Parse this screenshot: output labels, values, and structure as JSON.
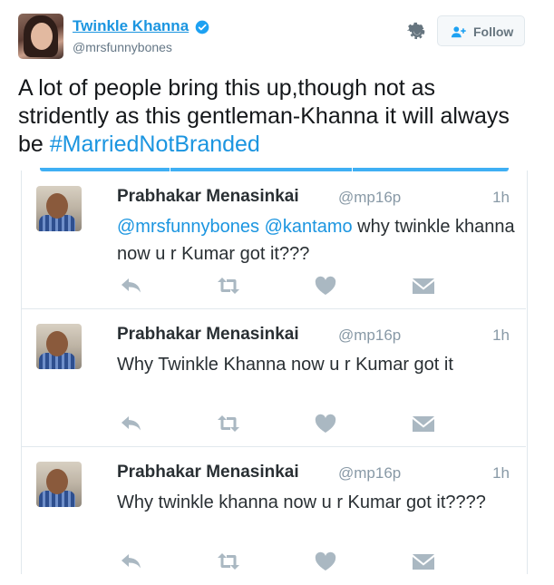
{
  "author": {
    "name": "Twinkle Khanna",
    "handle": "@mrsfunnybones"
  },
  "follow_label": "Follow",
  "tweet": {
    "text": "A lot of people bring this up,though not as stridently as this gentleman-Khanna it will always be ",
    "hashtag": "#MarriedNotBranded"
  },
  "replies": [
    {
      "name": "Prabhakar Menasinkai",
      "handle": "@mp16p",
      "time": "1h",
      "mentions": [
        "@mrsfunnybones",
        "@kantamo"
      ],
      "text": " why twinkle khanna now u r Kumar got it???"
    },
    {
      "name": "Prabhakar Menasinkai",
      "handle": "@mp16p",
      "time": "1h",
      "text": "Why Twinkle Khanna now u r Kumar got it"
    },
    {
      "name": "Prabhakar Menasinkai",
      "handle": "@mp16p",
      "time": "1h",
      "text": "Why twinkle khanna now u r Kumar got it????"
    }
  ],
  "icons": {
    "verified": "verified-badge-icon",
    "settings": "gear-icon",
    "follow": "add-user-icon",
    "reply": "reply-icon",
    "retweet": "retweet-icon",
    "like": "heart-icon",
    "dm": "envelope-icon"
  },
  "colors": {
    "link": "#1b95e0",
    "action_icon": "#aab8c2",
    "verified": "#1da1f2"
  }
}
